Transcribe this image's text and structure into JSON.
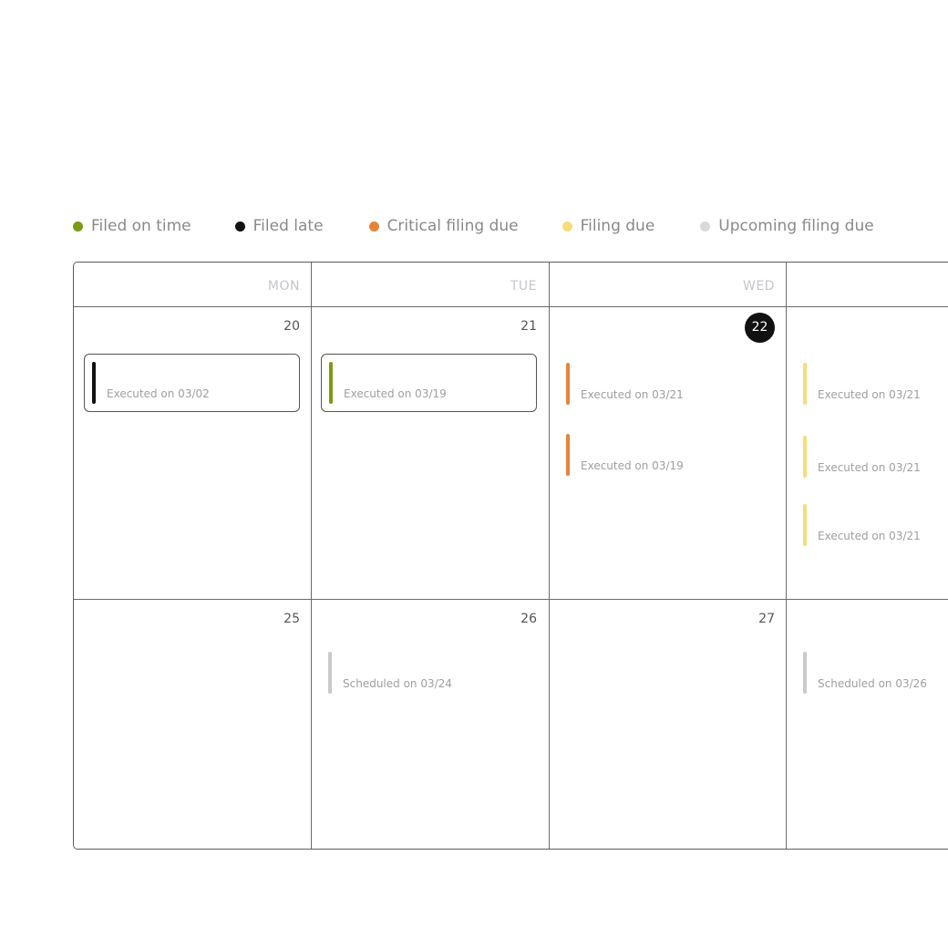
{
  "legend": [
    {
      "label": "Filed on time",
      "color": "#7a9a14",
      "icon": "dot-icon"
    },
    {
      "label": "Filed late",
      "color": "#111111",
      "icon": "dot-icon"
    },
    {
      "label": "Critical filing due",
      "color": "#e8843a",
      "icon": "dot-icon"
    },
    {
      "label": "Filing due",
      "color": "#f7dc7a",
      "icon": "dot-icon"
    },
    {
      "label": "Upcoming filing due",
      "color": "#d9d9d9",
      "icon": "dot-icon"
    }
  ],
  "days": [
    "MON",
    "TUE",
    "WED",
    ""
  ],
  "weeks": [
    {
      "dates": [
        "20",
        "21",
        "22",
        ""
      ],
      "today_index": 2,
      "events": [
        [
          {
            "text": "Executed on 03/02",
            "status": "Filed late",
            "color": "#111111",
            "selected": true
          }
        ],
        [
          {
            "text": "Executed on 03/19",
            "status": "Filed on time",
            "color": "#7a9a14",
            "selected": true
          }
        ],
        [
          {
            "text": "Executed on 03/21",
            "status": "Critical filing due",
            "color": "#e8843a",
            "selected": false
          },
          {
            "text": "Executed on 03/19",
            "status": "Critical filing due",
            "color": "#e8843a",
            "selected": false
          }
        ],
        [
          {
            "text": "Executed on 03/21",
            "status": "Filing due",
            "color": "#f7dc7a",
            "selected": false
          },
          {
            "text": "Executed on 03/21",
            "status": "Filing due",
            "color": "#f7dc7a",
            "selected": false
          },
          {
            "text": "Executed on 03/21",
            "status": "Filing due",
            "color": "#f7dc7a",
            "selected": false
          }
        ]
      ]
    },
    {
      "dates": [
        "25",
        "26",
        "27",
        ""
      ],
      "today_index": -1,
      "events": [
        [],
        [
          {
            "text": "Scheduled on 03/24",
            "status": "Upcoming filing due",
            "color": "#c9cbcc",
            "selected": false
          }
        ],
        [],
        [
          {
            "text": "Scheduled on 03/26",
            "status": "Upcoming filing due",
            "color": "#c9cbcc",
            "selected": false
          }
        ]
      ]
    }
  ]
}
